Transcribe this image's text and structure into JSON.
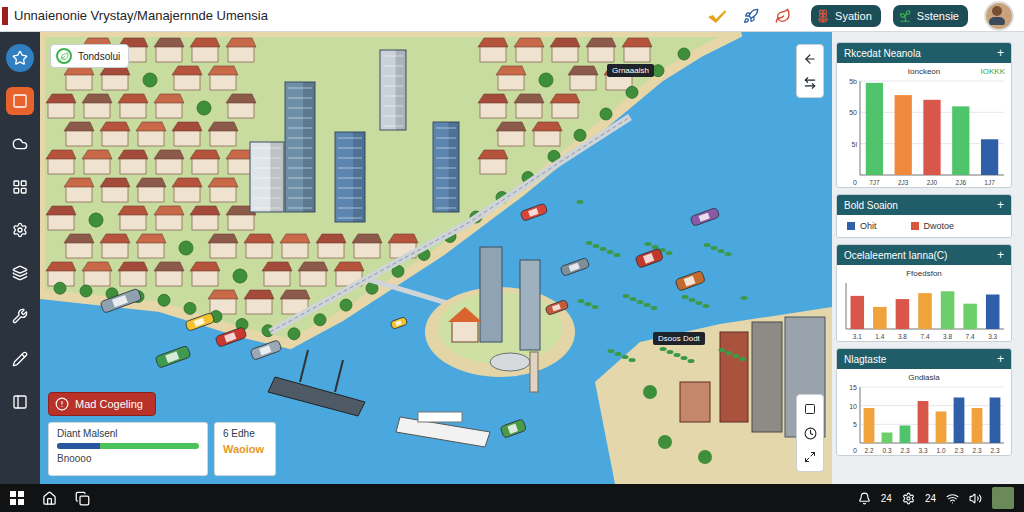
{
  "window": {
    "title": "Unnaienonie Vrystay/Manajernnde Umensia"
  },
  "header_buttons": [
    {
      "label": "Syation"
    },
    {
      "label": "Sstensie"
    }
  ],
  "sidebar": {
    "items": [
      {
        "selected": false
      },
      {
        "selected": true
      },
      {
        "selected": false
      },
      {
        "selected": false
      },
      {
        "selected": false
      },
      {
        "selected": false
      },
      {
        "selected": false
      },
      {
        "selected": false
      },
      {
        "selected": false
      }
    ]
  },
  "map": {
    "tag": "Tondsolui",
    "labels": [
      "Grnaaalsh",
      "Dsoos Dodt"
    ],
    "action_button": "Mad Cogeling"
  },
  "status_cards": [
    {
      "title": "Diant Malsenl",
      "level": 0.3,
      "value": "Bnoooo"
    },
    {
      "title": "6 Edhe",
      "value": "Waoiow"
    }
  ],
  "panels": [
    {
      "kind": "bar",
      "title": "Rkcedat Neanola",
      "action": "+",
      "subtitle": "Ionckeon",
      "badge": "IOKKK",
      "y_ticks": [
        "5b",
        "50",
        "5l"
      ],
      "origin": "0",
      "max": 100,
      "x_labels": [
        "7J7",
        "2J3",
        "2J0",
        "2J6",
        "1J7"
      ],
      "bars": [
        {
          "value": 98,
          "color": "#4fc46a"
        },
        {
          "value": 85,
          "color": "#f08a3c"
        },
        {
          "value": 80,
          "color": "#d9564a"
        },
        {
          "value": 73,
          "color": "#4fc46a"
        },
        {
          "value": 38,
          "color": "#2f5fa8"
        }
      ]
    },
    {
      "kind": "legend",
      "title": "Bold Soaion",
      "action": "+",
      "legend": [
        {
          "label": "Ohit",
          "color": "#2f5fa8"
        },
        {
          "label": "Dwotoe",
          "color": "#d9553a"
        }
      ]
    },
    {
      "kind": "bar",
      "title": "Ocelaleement Ianna(C)",
      "action": "+",
      "subtitle": "Ffoedsfon",
      "max": 100,
      "x_labels": [
        "3.1",
        "1.4",
        "3.8",
        "7.4",
        "3.8",
        "7.4",
        "3.3"
      ],
      "bars": [
        {
          "value": 72,
          "color": "#d9564a"
        },
        {
          "value": 48,
          "color": "#f0a23c"
        },
        {
          "value": 65,
          "color": "#d9564a"
        },
        {
          "value": 78,
          "color": "#f0a23c"
        },
        {
          "value": 82,
          "color": "#6ccf6a"
        },
        {
          "value": 55,
          "color": "#6ccf6a"
        },
        {
          "value": 75,
          "color": "#2f5fa8"
        }
      ]
    },
    {
      "kind": "bar",
      "title": "Nlagtaste",
      "action": "+",
      "subtitle": "Gndiasla",
      "y_ticks": [
        "15",
        "10",
        "5"
      ],
      "origin": "0",
      "max": 16,
      "x_labels": [
        "2.2",
        "0.3",
        "2.3",
        "3.3",
        "1.0",
        "2.3",
        "2.3",
        "2.3"
      ],
      "bars": [
        {
          "value": 10,
          "color": "#f0a23c"
        },
        {
          "value": 3,
          "color": "#6ccf6a"
        },
        {
          "value": 5,
          "color": "#4fc46a"
        },
        {
          "value": 12,
          "color": "#d9564a"
        },
        {
          "value": 9,
          "color": "#f0a23c"
        },
        {
          "value": 13,
          "color": "#2f5fa8"
        },
        {
          "value": 10,
          "color": "#f0a23c"
        },
        {
          "value": 13,
          "color": "#2f5fa8"
        }
      ]
    }
  ],
  "taskbar": {
    "tray": [
      "24",
      "24"
    ]
  }
}
